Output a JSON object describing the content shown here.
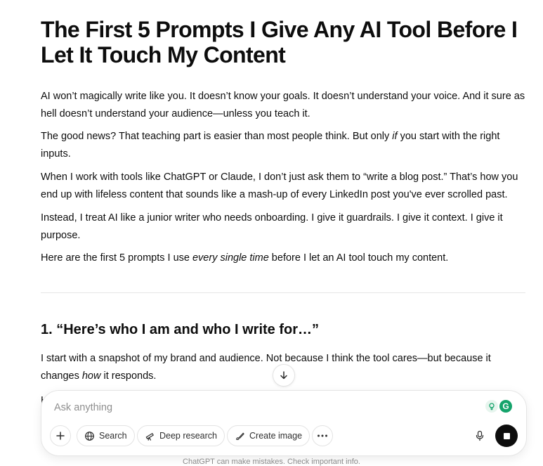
{
  "article": {
    "title": "The First 5 Prompts I Give Any AI Tool Before I Let It Touch My Content",
    "p1": "AI won’t magically write like you. It doesn’t know your goals. It doesn’t understand your voice. And it sure as hell doesn’t understand your audience—unless you teach it.",
    "p2_a": "The good news? That teaching part is easier than most people think. But only ",
    "p2_em": "if",
    "p2_b": " you start with the right inputs.",
    "p3": "When I work with tools like ChatGPT or Claude, I don’t just ask them to “write a blog post.” That’s how you end up with lifeless content that sounds like a mash-up of every LinkedIn post you've ever scrolled past.",
    "p4": "Instead, I treat AI like a junior writer who needs onboarding. I give it guardrails. I give it context. I give it purpose.",
    "p5_a": "Here are the first 5 prompts I use ",
    "p5_em": "every single time",
    "p5_b": " before I let an AI tool touch my content.",
    "h2": "1. “Here’s who I am and who I write for…”",
    "p6_a": "I start with a snapshot of my brand and audience. Not because I think the tool cares—but because it changes ",
    "p6_em": "how",
    "p6_b": " it responds.",
    "p7_cut": "H"
  },
  "composer": {
    "placeholder": "Ask anything",
    "search_label": "Search",
    "deep_research_label": "Deep research",
    "create_image_label": "Create image",
    "grammarly_letter": "G"
  },
  "footer": {
    "text": "ChatGPT can make mistakes. Check important info."
  }
}
